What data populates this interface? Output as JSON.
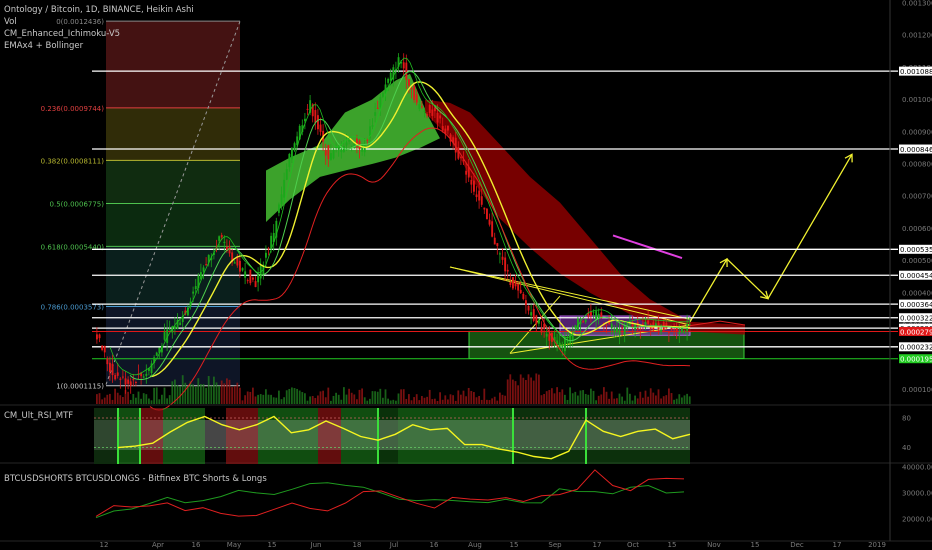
{
  "header": {
    "title": "Ontology / Bitcoin, 1D, BINANCE, Heikin Ashi",
    "line2": "Vol",
    "line3": "CM_Enhanced_Ichimoku-V5",
    "line4": "EMAx4 + Bollinger"
  },
  "colors": {
    "up": "#1aa81a",
    "down": "#e01818",
    "axis": "#9a9a9a",
    "panelSep": "#262626"
  },
  "chart_data": [
    {
      "type": "line",
      "title": "Ontology / Bitcoin, 1D, BINANCE, Heikin Ashi",
      "price_axis_labels": [
        "0.0013000",
        "0.0012000",
        "0.0011000",
        "0.0010000",
        "0.0009000",
        "0.0008000",
        "0.0007000",
        "0.0006000",
        "0.0005000",
        "0.0004000",
        "0.0003000",
        "0.0002000",
        "0.0001000"
      ],
      "x_axis_labels": [
        "12",
        "Apr",
        "16",
        "May",
        "15",
        "Jun",
        "18",
        "Jul",
        "16",
        "Aug",
        "15",
        "Sep",
        "17",
        "Oct",
        "15",
        "Nov",
        "15",
        "Dec",
        "17",
        "2019"
      ],
      "horizontal_levels": [
        {
          "value": 0.0010884,
          "label": "0.0010884",
          "color": "#ffffff"
        },
        {
          "value": 0.0008465,
          "label": "0.0008465",
          "color": "#ffffff"
        },
        {
          "value": 0.0005351,
          "label": "0.0005351",
          "color": "#ffffff"
        },
        {
          "value": 0.0004546,
          "label": "0.0004546",
          "color": "#ffffff"
        },
        {
          "value": 0.0003648,
          "label": "0.0003648",
          "color": "#ffffff"
        },
        {
          "value": 0.0003226,
          "label": "0.0003226",
          "color": "#ffffff"
        },
        {
          "value": 0.0002903,
          "label": "0.0002903",
          "color": "#ffffff"
        },
        {
          "value": 0.0002799,
          "label": "0.0002799",
          "color": "#e01818"
        },
        {
          "value": 0.0002323,
          "label": "0.0002323",
          "color": "#ffffff"
        },
        {
          "value": 0.0001953,
          "label": "0.0001953",
          "color": "#22cc22"
        }
      ],
      "fibonacci_labels": [
        {
          "label": "0(0.0012436)",
          "value": 0.0012436,
          "color": "#888888"
        },
        {
          "label": "0.236(0.0009744)",
          "value": 0.0009744,
          "color": "#e04040"
        },
        {
          "label": "0.382(0.0008111)",
          "value": 0.0008111,
          "color": "#b8b830"
        },
        {
          "label": "0.5(0.0006775)",
          "value": 0.0006775,
          "color": "#4ec24e"
        },
        {
          "label": "0.618(0.0005440)",
          "value": 0.000544,
          "color": "#4ec24e"
        },
        {
          "label": "0.786(0.0003573)",
          "value": 0.0003573,
          "color": "#4a9ad0"
        },
        {
          "label": "1(0.0001115)",
          "value": 0.0001115,
          "color": "#c8c8c8"
        }
      ],
      "price_path": [
        [
          0.000298,
          0.00015,
          0.00012,
          0.000155,
          0.00027,
          0.00033,
          0.00047,
          0.00057,
          0.00048,
          0.00043,
          0.00059,
          0.00085,
          0.00099,
          0.00082,
          0.00087,
          0.00085,
          0.00102,
          0.00113,
          0.00098,
          0.00095,
          0.00086,
          0.00074,
          0.0006,
          0.00045,
          0.00036,
          0.00028,
          0.00023,
          0.00032,
          0.00033,
          0.000285,
          0.0003,
          0.000295,
          0.00029,
          0.00029
        ]
      ]
    },
    {
      "type": "line",
      "title": "CM_Ult_RSI_MTF",
      "y_axis_labels": [
        "80",
        "40"
      ],
      "series": [
        {
          "values": [
            40,
            42,
            46,
            61,
            74,
            82,
            71,
            64,
            71,
            82,
            60,
            64,
            76,
            66,
            55,
            50,
            58,
            71,
            64,
            66,
            44,
            44,
            38,
            34,
            28,
            25,
            35,
            77,
            62,
            55,
            62,
            65,
            52,
            58
          ]
        }
      ]
    },
    {
      "type": "line",
      "title": "BTCUSDSHORTS BTCUSDLONGS - Bitfinex BTC Shorts & Longs",
      "y_axis_labels": [
        "40000.00",
        "30000.00",
        "20000.00"
      ],
      "series": [
        {
          "values": [
            20500,
            22500,
            24000,
            26500,
            28000,
            25800,
            27500,
            29000,
            30500,
            29800,
            30000,
            31500,
            33000,
            34000,
            33500,
            32000,
            29500,
            28000,
            27500,
            27000,
            26800,
            27200,
            26500,
            27000,
            26200,
            26800,
            31500,
            30000,
            30800,
            30200,
            31800,
            32500,
            30500,
            30700
          ]
        },
        {
          "values": [
            21000,
            24500,
            25500,
            24500,
            26000,
            24000,
            23500,
            22500,
            21500,
            20500,
            24500,
            26000,
            23500,
            24000,
            25500,
            30500,
            31500,
            27500,
            26500,
            24500,
            27500,
            28500,
            27000,
            27800,
            27600,
            28200,
            29500,
            32000,
            38000,
            33500,
            31000,
            34500,
            36500,
            35000
          ]
        }
      ]
    }
  ]
}
